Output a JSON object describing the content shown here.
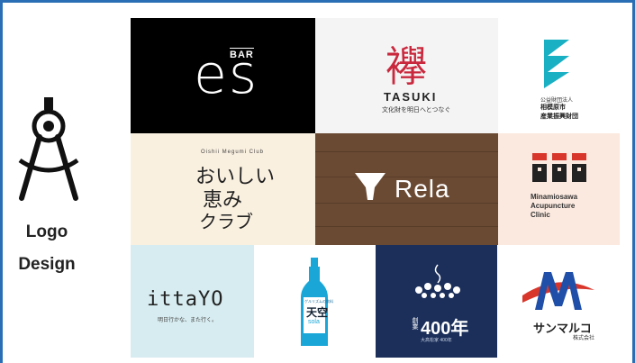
{
  "side": {
    "icon": "drafting-compass-icon",
    "line1": "Logo",
    "line2": "Design"
  },
  "colors": {
    "frame": "#2a6fb5",
    "teal": "#1ab0c4",
    "red": "#d9362b",
    "navy": "#1b2f5a",
    "blue": "#1f4fa8"
  },
  "logos": {
    "es": {
      "bar": "BAR",
      "mark": "es"
    },
    "tasuki": {
      "kanji": "襷",
      "name": "TASUKI",
      "sub": "文化財を明日へとつなぐ"
    },
    "teal": {
      "sub1": "公益財団法人",
      "sub2": "相模原市",
      "sub3": "産業振興財団"
    },
    "oishii": {
      "small": "Oishii Megumi Club",
      "line1": "おいしい",
      "line2": "恵み",
      "line3": "クラブ"
    },
    "rela": {
      "name": "Rela"
    },
    "mina": {
      "line1": "Minamiosawa",
      "line2": "Acupuncture",
      "line3": "Clinic"
    },
    "itta": {
      "name": "ittaYO",
      "sub": "明日行かな、また行く。"
    },
    "sola": {
      "small": "ゲルリズムの飲料",
      "kanji": "天空",
      "name": "sola"
    },
    "anniv": {
      "side": "創業",
      "number": "400年",
      "sub": "大高松家 400年"
    },
    "sun": {
      "name": "サンマルコ",
      "sub": "株式会社"
    }
  }
}
